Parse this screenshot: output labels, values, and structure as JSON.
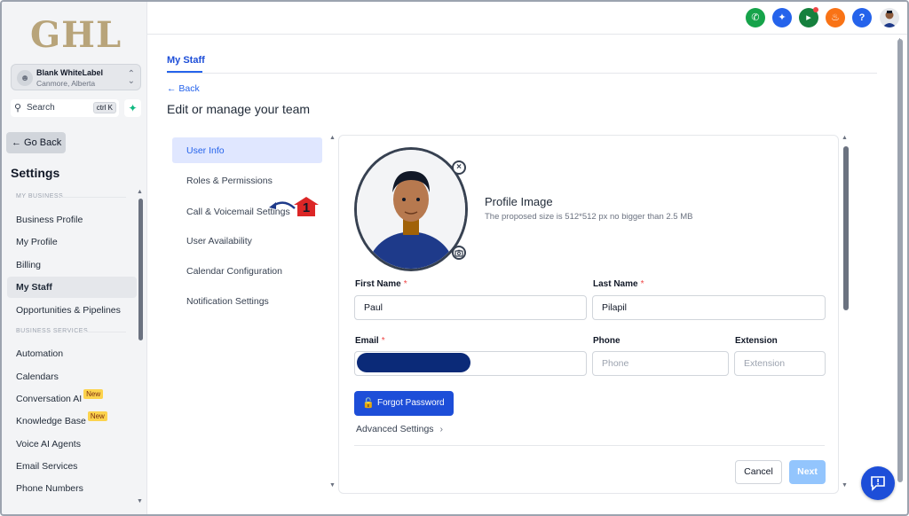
{
  "brand": {
    "logo_text": "GHL"
  },
  "account": {
    "name": "Blank WhiteLabel",
    "location": "Canmore, Alberta"
  },
  "search": {
    "label": "Search",
    "shortcut": "ctrl K"
  },
  "sidebar": {
    "go_back": "← Go Back",
    "title": "Settings",
    "section_my_business": "MY BUSINESS",
    "section_business_services": "BUSINESS SERVICES",
    "items": [
      {
        "label": "Business Profile"
      },
      {
        "label": "My Profile"
      },
      {
        "label": "Billing"
      },
      {
        "label": "My Staff",
        "active": true
      },
      {
        "label": "Opportunities & Pipelines"
      },
      {
        "label": "Automation"
      },
      {
        "label": "Calendars"
      },
      {
        "label": "Conversation AI",
        "badge": "New"
      },
      {
        "label": "Knowledge Base",
        "badge": "New"
      },
      {
        "label": "Voice AI Agents"
      },
      {
        "label": "Email Services"
      },
      {
        "label": "Phone Numbers"
      }
    ]
  },
  "topbar": {
    "icons": [
      {
        "name": "phone-icon",
        "color": "#16a34a"
      },
      {
        "name": "magic-icon",
        "color": "#2563eb"
      },
      {
        "name": "megaphone-icon",
        "color": "#15803d"
      },
      {
        "name": "bell-icon",
        "color": "#f97316"
      },
      {
        "name": "help-icon",
        "color": "#2563eb"
      }
    ],
    "help_glyph": "?"
  },
  "main": {
    "tab": "My Staff",
    "back": "← Back",
    "title": "Edit or manage your team",
    "subnav": [
      {
        "label": "User Info",
        "active": true
      },
      {
        "label": "Roles & Permissions"
      },
      {
        "label": "Call & Voicemail Settings"
      },
      {
        "label": "User Availability"
      },
      {
        "label": "Calendar Configuration"
      },
      {
        "label": "Notification Settings"
      }
    ],
    "callout_number": "1"
  },
  "form": {
    "profile_image_title": "Profile Image",
    "profile_image_sub": "The proposed size is 512*512 px no bigger than 2.5 MB",
    "first_name_label": "First Name",
    "first_name_value": "Paul",
    "last_name_label": "Last Name",
    "last_name_value": "Pilapil",
    "email_label": "Email",
    "phone_label": "Phone",
    "phone_placeholder": "Phone",
    "extension_label": "Extension",
    "extension_placeholder": "Extension",
    "required_mark": "*",
    "forgot_password": "Forgot Password",
    "advanced_settings": "Advanced Settings",
    "cancel": "Cancel",
    "next": "Next"
  },
  "colors": {
    "accent": "#2563eb",
    "badge": "#fcd34d",
    "redaction": "#0b2a78"
  }
}
